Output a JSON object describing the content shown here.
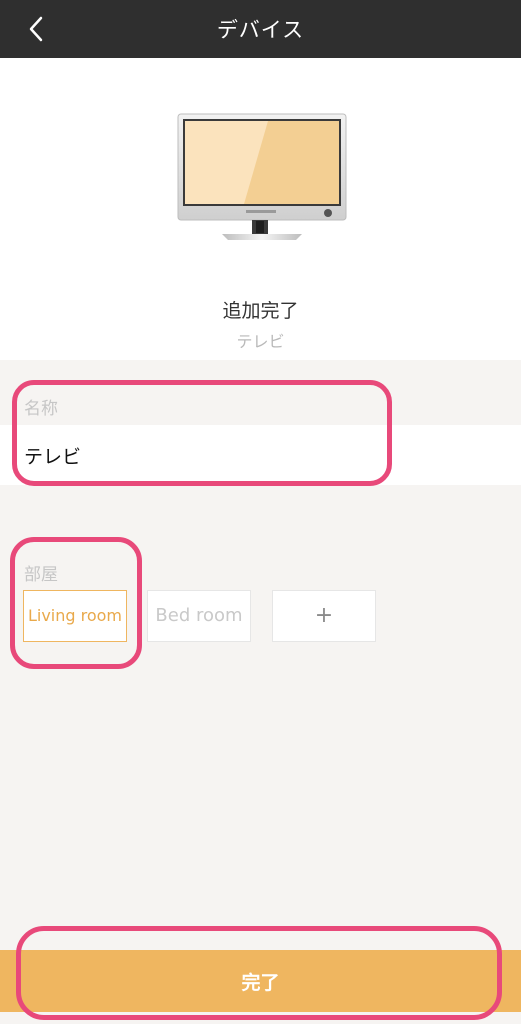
{
  "header": {
    "title": "デバイス",
    "back_icon": "chevron-left-icon"
  },
  "device": {
    "illustration": "tv-icon",
    "status_title": "追加完了",
    "status_subtitle": "テレビ"
  },
  "name_section": {
    "label": "名称",
    "value": "テレビ"
  },
  "room_section": {
    "label": "部屋",
    "rooms": [
      {
        "label": "Living room",
        "selected": true
      },
      {
        "label": "Bed room",
        "selected": false
      }
    ],
    "add_label": "+"
  },
  "footer": {
    "done_label": "完了"
  },
  "colors": {
    "header_bg": "#2f2f2f",
    "accent": "#efb660",
    "selected_text": "#e9a94b",
    "highlight": "#e8497a",
    "background": "#f6f4f2"
  }
}
